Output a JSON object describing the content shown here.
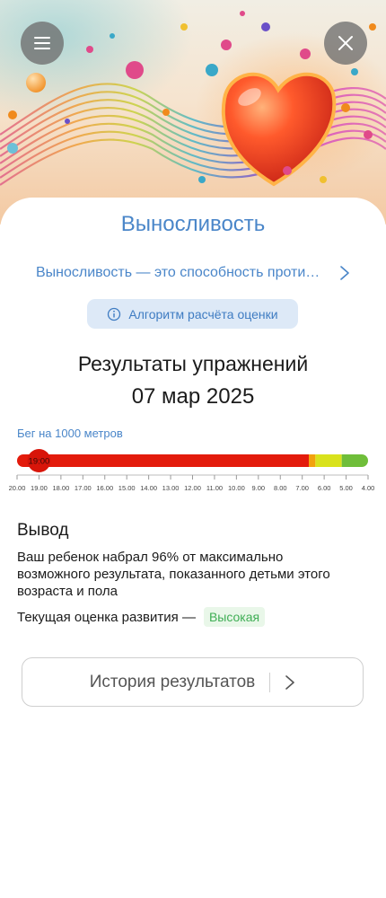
{
  "header": {
    "menu_icon": "hamburger-menu-icon",
    "close_icon": "close-icon",
    "hero_image": "decorative heart illustration"
  },
  "quality": {
    "title": "Выносливость",
    "description": "Выносливость — это способность противостоять утомлению",
    "description_visible": "Выносливость — это способность проти…",
    "algorithm_label": "Алгоритм расчёта оценки"
  },
  "results": {
    "title": "Результаты упражнений",
    "date": "07 мар 2025",
    "exercise_label": "Бег на 1000 метров",
    "result_value": "19:00",
    "result_time_minutes": 19.0,
    "scale_ticks": [
      "20.00",
      "19.00",
      "18.00",
      "17.00",
      "16.00",
      "15.00",
      "14.00",
      "13.00",
      "12.00",
      "11.00",
      "10.00",
      "9.00",
      "8.00",
      "7.00",
      "6.00",
      "5.00",
      "4.00"
    ],
    "scale_min": 20.0,
    "scale_max": 4.0,
    "segments": [
      {
        "from": 20.0,
        "to": 6.7,
        "color": "#e31b0c"
      },
      {
        "from": 6.7,
        "to": 6.4,
        "color": "#f2a20c"
      },
      {
        "from": 6.4,
        "to": 5.2,
        "color": "#d9e21c"
      },
      {
        "from": 5.2,
        "to": 4.0,
        "color": "#6fbe3a"
      }
    ]
  },
  "conclusion": {
    "title": "Вывод",
    "text": "Ваш ребенок набрал 96% от максимально возможного результата, показанного детьми этого возраста и пола",
    "assessment_label": "Текущая оценка развития —",
    "assessment_value": "Высокая"
  },
  "history": {
    "label": "История результатов"
  },
  "colors": {
    "accent": "#4a86c9",
    "badge_bg": "#e9f7e9",
    "badge_text": "#3fae55"
  }
}
